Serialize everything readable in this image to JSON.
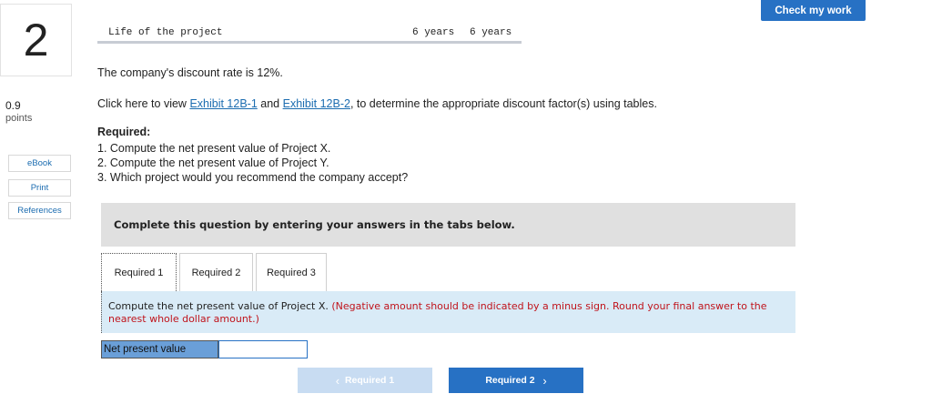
{
  "question": {
    "number": "2",
    "points_value": "0.9",
    "points_label": "points"
  },
  "sidebar": {
    "ebook": "eBook",
    "print": "Print",
    "references": "References"
  },
  "header": {
    "check_my_work": "Check my work"
  },
  "life_row": {
    "label": "Life of the project",
    "col1": "6 years",
    "col2": "6 years"
  },
  "intro": {
    "discount_rate": "The company's discount rate is 12%.",
    "click_prefix": "Click here to view ",
    "exhibit1": "Exhibit 12B-1",
    "and": " and ",
    "exhibit2": "Exhibit 12B-2",
    "click_suffix": ", to determine the appropriate discount factor(s) using tables."
  },
  "required": {
    "heading": "Required:",
    "items": [
      "1. Compute the net present value of Project X.",
      "2. Compute the net present value of Project Y.",
      "3. Which project would you recommend the company accept?"
    ]
  },
  "banner": "Complete this question by entering your answers in the tabs below.",
  "tabs": [
    {
      "label": "Required 1",
      "active": true
    },
    {
      "label": "Required 2",
      "active": false
    },
    {
      "label": "Required 3",
      "active": false
    }
  ],
  "instruction": {
    "main": "Compute the net present value of Project X. ",
    "note": "(Negative amount should be indicated by a minus sign. Round your final answer to the nearest whole dollar amount.)"
  },
  "npv": {
    "label": "Net present value",
    "value": ""
  },
  "nav": {
    "prev": "Required 1",
    "next": "Required 2"
  },
  "colors": {
    "accent": "#2771c4",
    "note_red": "#c0131b",
    "label_bg": "#6a9fd8",
    "tab_panel_bg": "#d9ebf7"
  }
}
